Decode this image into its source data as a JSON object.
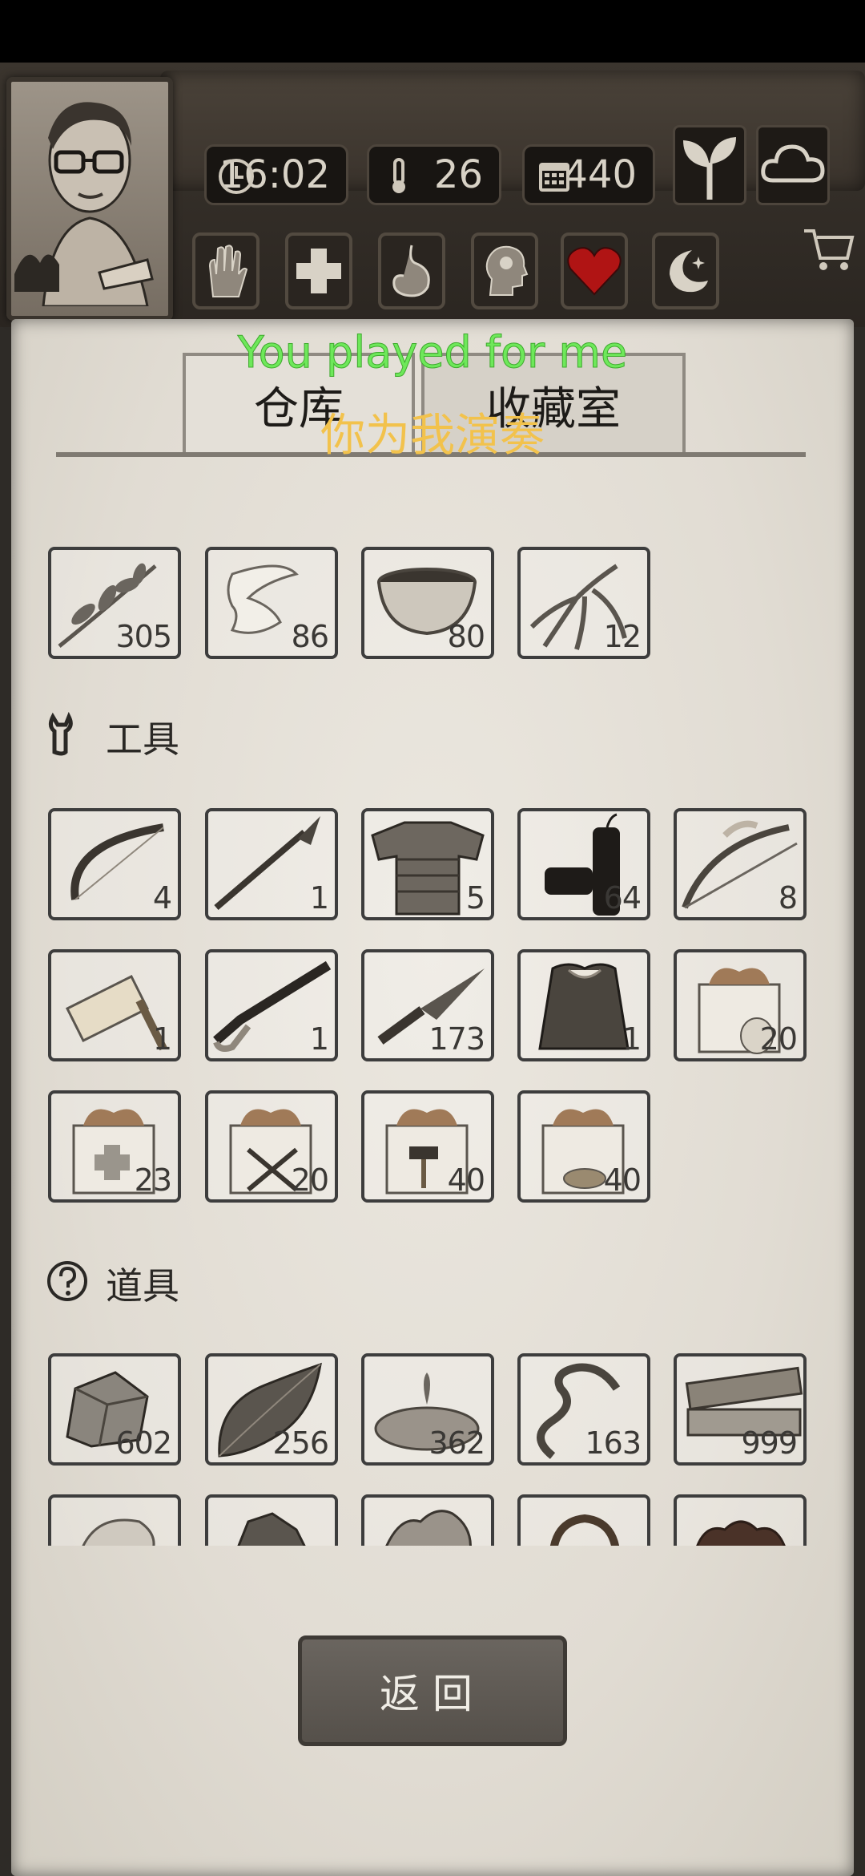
{
  "hud": {
    "time": "16:02",
    "temperature": "26",
    "days": "440",
    "icons": [
      "clock-icon",
      "thermometer-icon",
      "calendar-icon",
      "sprout-icon",
      "cloud-icon",
      "cart-icon"
    ]
  },
  "status_buttons": [
    "hand-injury-icon",
    "first-aid-icon",
    "stomach-icon",
    "mind-icon",
    "heart-icon",
    "moon-icon"
  ],
  "tabs": {
    "warehouse": "仓库",
    "collection": "收藏室"
  },
  "overlay": {
    "english": "You played for me",
    "chinese": "你为我演奏"
  },
  "sections": {
    "tools_label": "工具",
    "props_label": "道具"
  },
  "items": {
    "row1": [
      {
        "name": "herb",
        "count": "305"
      },
      {
        "name": "bandage",
        "count": "86"
      },
      {
        "name": "bowl",
        "count": "80"
      },
      {
        "name": "ginseng",
        "count": "12"
      }
    ],
    "tools": [
      {
        "name": "bow",
        "count": "4"
      },
      {
        "name": "spear",
        "count": "1"
      },
      {
        "name": "armor",
        "count": "5"
      },
      {
        "name": "firecracker",
        "count": "64"
      },
      {
        "name": "crossbow",
        "count": "8"
      },
      {
        "name": "flashlight",
        "count": "1"
      },
      {
        "name": "rifle",
        "count": "1"
      },
      {
        "name": "kunai",
        "count": "173"
      },
      {
        "name": "fur-coat",
        "count": "1"
      },
      {
        "name": "gift-box-seeds",
        "count": "20"
      },
      {
        "name": "gift-box-medical",
        "count": "23"
      },
      {
        "name": "gift-box-weapons",
        "count": "20"
      },
      {
        "name": "gift-box-hammer",
        "count": "40"
      },
      {
        "name": "gift-box-wood",
        "count": "40"
      }
    ],
    "props": [
      {
        "name": "stone",
        "count": "602"
      },
      {
        "name": "leaf",
        "count": "256"
      },
      {
        "name": "water",
        "count": "362"
      },
      {
        "name": "vine",
        "count": "163"
      },
      {
        "name": "planks",
        "count": "999"
      }
    ],
    "props_partial": [
      "rock",
      "ore",
      "fiber",
      "rope",
      "clay"
    ]
  },
  "back_button": "返回",
  "colors": {
    "paper": "#e6e2da",
    "wood": "#3b352e",
    "heart": "#b01414",
    "overlay_en": "#6ee85a",
    "overlay_zh": "#f2c24c"
  }
}
